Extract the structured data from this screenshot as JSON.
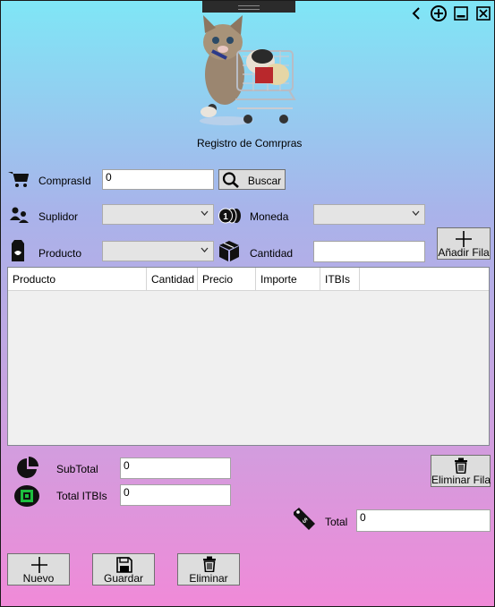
{
  "window": {
    "title": "Registro de Comrpras",
    "controls": [
      "back-icon",
      "add-circle-icon",
      "minimize-icon",
      "close-icon"
    ]
  },
  "form": {
    "compras_id_label": "ComprasId",
    "compras_id_value": "0",
    "buscar_label": "Buscar",
    "suplidor_label": "Suplidor",
    "suplidor_value": "",
    "moneda_label": "Moneda",
    "moneda_value": "",
    "producto_label": "Producto",
    "producto_value": "",
    "cantidad_label": "Cantidad",
    "cantidad_value": "",
    "anadir_fila_label": "Añadir Fila"
  },
  "grid": {
    "columns": [
      "Producto",
      "Cantidad",
      "Precio",
      "Importe",
      "ITBIs"
    ],
    "rows": []
  },
  "totals": {
    "subtotal_label": "SubTotal",
    "subtotal_value": "0",
    "total_itbis_label": "Total ITBIs",
    "total_itbis_value": "0",
    "eliminar_fila_label": "Eliminar Fila",
    "total_label": "Total",
    "total_value": "0"
  },
  "actions": {
    "nuevo_label": "Nuevo",
    "guardar_label": "Guardar",
    "eliminar_label": "Eliminar"
  }
}
